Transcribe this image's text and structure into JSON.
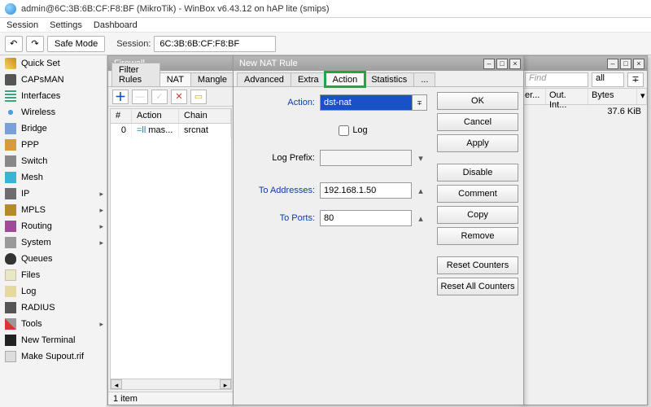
{
  "title": "admin@6C:3B:6B:CF:F8:BF (MikroTik) - WinBox v6.43.12 on hAP lite (smips)",
  "menus": {
    "m0": "Session",
    "m1": "Settings",
    "m2": "Dashboard"
  },
  "toolbar": {
    "safemode": "Safe Mode",
    "session_label": "Session:",
    "session_value": "6C:3B:6B:CF:F8:BF"
  },
  "sidebar": [
    {
      "label": "Quick Set",
      "icon": "i-wand"
    },
    {
      "label": "CAPsMAN",
      "icon": "i-cap"
    },
    {
      "label": "Interfaces",
      "icon": "i-int"
    },
    {
      "label": "Wireless",
      "icon": "i-wifi"
    },
    {
      "label": "Bridge",
      "icon": "i-bridge"
    },
    {
      "label": "PPP",
      "icon": "i-ppp"
    },
    {
      "label": "Switch",
      "icon": "i-switch"
    },
    {
      "label": "Mesh",
      "icon": "i-mesh"
    },
    {
      "label": "IP",
      "icon": "i-ip",
      "sub": true
    },
    {
      "label": "MPLS",
      "icon": "i-mpls",
      "sub": true
    },
    {
      "label": "Routing",
      "icon": "i-route",
      "sub": true
    },
    {
      "label": "System",
      "icon": "i-sys",
      "sub": true
    },
    {
      "label": "Queues",
      "icon": "i-queue"
    },
    {
      "label": "Files",
      "icon": "i-files"
    },
    {
      "label": "Log",
      "icon": "i-log"
    },
    {
      "label": "RADIUS",
      "icon": "i-radius"
    },
    {
      "label": "Tools",
      "icon": "i-tools",
      "sub": true
    },
    {
      "label": "New Terminal",
      "icon": "i-term"
    },
    {
      "label": "Make Supout.rif",
      "icon": "i-supout"
    }
  ],
  "firewall": {
    "title": "Firewall",
    "tabs": {
      "t0": "Filter Rules",
      "t1": "NAT",
      "t2": "Mangle"
    },
    "cols": {
      "c0": "#",
      "c1": "Action",
      "c2": "Chain"
    },
    "row": {
      "n": "0",
      "action": "mas...",
      "chain": "srcnat",
      "icon": "=ll"
    },
    "status": "1 item"
  },
  "nat": {
    "title": "New NAT Rule",
    "tabs": {
      "t0": "Advanced",
      "t1": "Extra",
      "t2": "Action",
      "t3": "Statistics",
      "t4": "..."
    },
    "labels": {
      "action": "Action:",
      "log": "Log",
      "logprefix": "Log Prefix:",
      "toaddr": "To Addresses:",
      "toports": "To Ports:"
    },
    "values": {
      "action": "dst-nat",
      "toaddr": "192.168.1.50",
      "toports": "80"
    },
    "buttons": {
      "ok": "OK",
      "cancel": "Cancel",
      "apply": "Apply",
      "disable": "Disable",
      "comment": "Comment",
      "copy": "Copy",
      "remove": "Remove",
      "resetc": "Reset Counters",
      "resetall": "Reset All Counters"
    }
  },
  "backlist": {
    "find_ph": "Find",
    "all": "all",
    "cols": {
      "c0": "er...",
      "c1": "Out. Int...",
      "c2": "Bytes"
    },
    "row_bytes": "37.6 KiB"
  }
}
